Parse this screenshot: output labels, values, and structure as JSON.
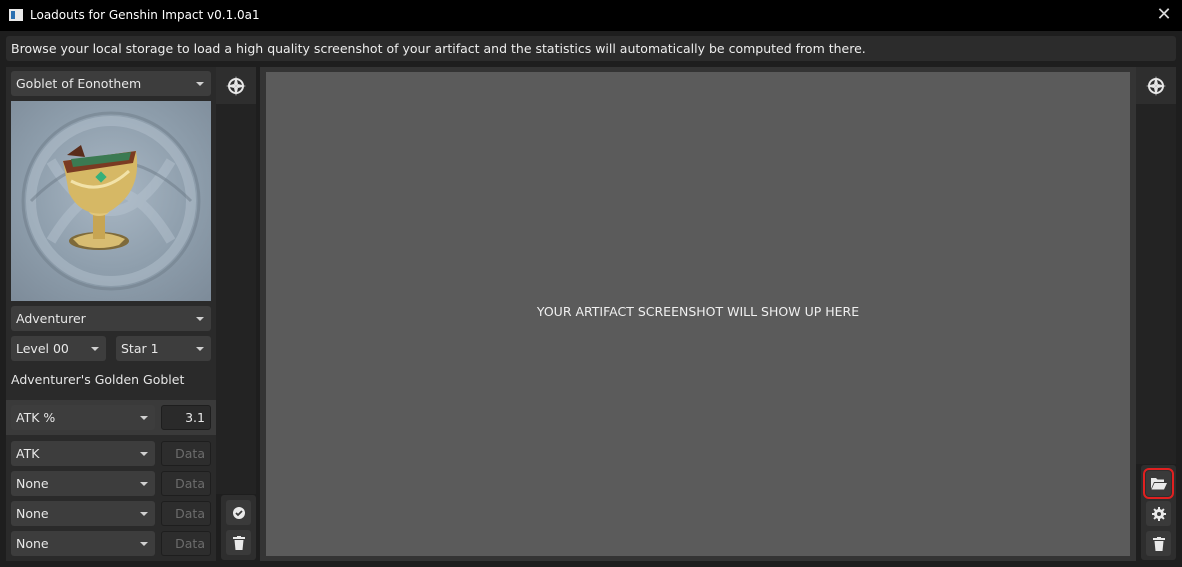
{
  "window": {
    "title": "Loadouts for Genshin Impact v0.1.0a1",
    "close_glyph": "✕"
  },
  "infobar": {
    "text": "Browse your local storage to load a high quality screenshot of your artifact and the statistics will automatically be computed from there."
  },
  "artifact": {
    "type_select": "Goblet of Eonothem",
    "set_select": "Adventurer",
    "level_select": "Level 00",
    "rarity_select": "Star 1",
    "name": "Adventurer's Golden Goblet",
    "image_icon": "golden-goblet-icon",
    "main_stat": {
      "name": "ATK %",
      "value": "3.1"
    },
    "substats": [
      {
        "name": "ATK",
        "placeholder": "Data"
      },
      {
        "name": "None",
        "placeholder": "Data"
      },
      {
        "name": "None",
        "placeholder": "Data"
      },
      {
        "name": "None",
        "placeholder": "Data"
      }
    ]
  },
  "preview": {
    "placeholder_text": "YOUR ARTIFACT SCREENSHOT WILL SHOW UP HERE"
  },
  "toolbar": {
    "icons": [
      "compass-icon",
      "check-circle-icon",
      "trash-icon",
      "folder-open-icon",
      "gear-icon"
    ],
    "highlight_color": "#e02020"
  }
}
